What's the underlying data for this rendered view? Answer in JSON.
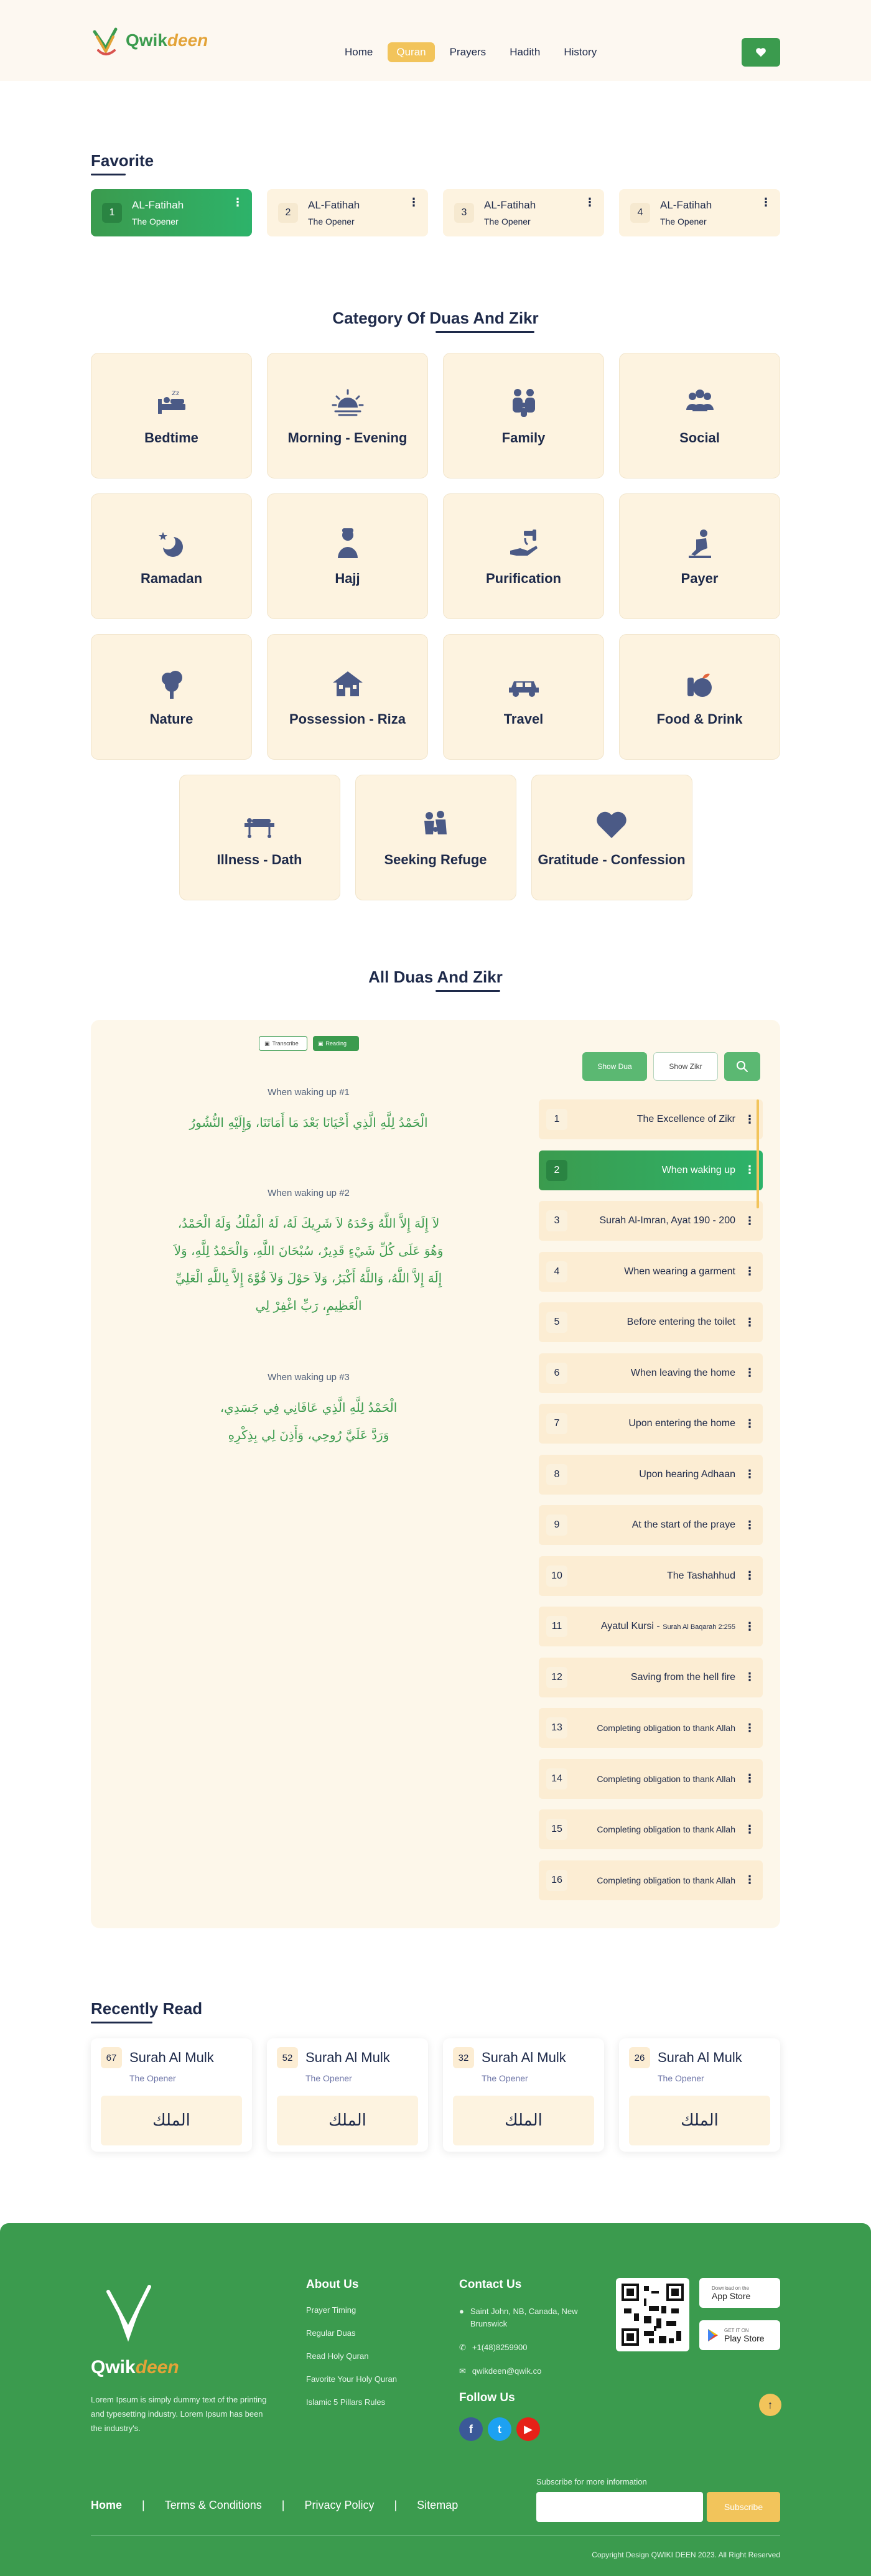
{
  "header": {
    "logo_prefix": "Qwik",
    "logo_suffix": "deen",
    "nav": [
      "Home",
      "Quran",
      "Prayers",
      "Hadith",
      "History"
    ],
    "active_nav": "Quran"
  },
  "favorite": {
    "title": "Favorite",
    "cards": [
      {
        "num": "1",
        "title": "AL-Fatihah",
        "sub": "The Opener"
      },
      {
        "num": "2",
        "title": "AL-Fatihah",
        "sub": "The Opener"
      },
      {
        "num": "3",
        "title": "AL-Fatihah",
        "sub": "The Opener"
      },
      {
        "num": "4",
        "title": "AL-Fatihah",
        "sub": "The Opener"
      }
    ]
  },
  "categories": {
    "title": "Category Of Duas And Zikr",
    "items": [
      {
        "label": "Bedtime",
        "icon": "bed-icon"
      },
      {
        "label": "Morning - Evening",
        "icon": "sunrise-icon"
      },
      {
        "label": "Family",
        "icon": "family-icon"
      },
      {
        "label": "Social",
        "icon": "people-icon"
      },
      {
        "label": "Ramadan",
        "icon": "crescent-icon"
      },
      {
        "label": "Hajj",
        "icon": "pilgrim-icon"
      },
      {
        "label": "Purification",
        "icon": "water-tap-icon"
      },
      {
        "label": "Payer",
        "icon": "prayer-icon"
      },
      {
        "label": "Nature",
        "icon": "tree-icon"
      },
      {
        "label": "Possession - Riza",
        "icon": "house-icon"
      },
      {
        "label": "Travel",
        "icon": "car-icon"
      },
      {
        "label": "Food & Drink",
        "icon": "food-icon"
      },
      {
        "label": "Illness - Dath",
        "icon": "stretcher-icon"
      },
      {
        "label": "Seeking Refuge",
        "icon": "refuge-icon"
      },
      {
        "label": "Gratitude - Confession",
        "icon": "heart-icon"
      }
    ]
  },
  "all_duas": {
    "title": "All Duas And Zikr",
    "toggle_left": "Transcribe",
    "toggle_right": "Reading",
    "show_dua": "Show Dua",
    "show_zikr": "Show Zikr",
    "duas": [
      {
        "head": "When waking up #1",
        "lines": [
          "الْحَمْدُ لِلَّهِ الَّذِي أَحْيَانَا بَعْدَ مَا أَمَاتَنَا، وَإِلَيْهِ النُّشُورُ"
        ]
      },
      {
        "head": "When waking up #2",
        "lines": [
          "لاَ إِلَهَ إِلاَّ اللَّهُ وَحْدَهُ لاَ شَرِيكَ لَهُ، لَهُ الْمُلْكُ وَلَهُ الْحَمْدُ،",
          "وَهُوَ عَلَى كُلِّ شَيْءٍ قَدِيرٌ، سُبْحَانَ اللَّهِ، وَالْحَمْدُ لِلَّهِ، وَلاَ",
          "إِلَهَ إِلاَّ اللَّهُ، وَاللَّهُ أَكْبَرُ، وَلاَ حَوْلَ وَلاَ قُوَّةَ إِلاَّ بِاللَّهِ الْعَلِيِّ",
          "الْعَظِيمِ، رَبِّ اغْفِرْ لِي"
        ]
      },
      {
        "head": "When waking up #3",
        "lines": [
          "الْحَمْدُ لِلَّهِ الَّذِي عَافَانِي فِي جَسَدِي،",
          "وَرَدَّ عَلَيَّ رُوحِي، وَأَذِنَ لِي بِذِكْرِهِ"
        ]
      }
    ],
    "list": [
      {
        "num": "1",
        "title": "The Excellence of Zikr"
      },
      {
        "num": "2",
        "title": "When waking up"
      },
      {
        "num": "3",
        "title": "Surah Al-Imran, Ayat 190 - 200"
      },
      {
        "num": "4",
        "title": "When wearing a garment"
      },
      {
        "num": "5",
        "title": "Before entering the toilet"
      },
      {
        "num": "6",
        "title": "When leaving the home"
      },
      {
        "num": "7",
        "title": "Upon entering the home"
      },
      {
        "num": "8",
        "title": "Upon hearing Adhaan"
      },
      {
        "num": "9",
        "title": "At the start of the praye"
      },
      {
        "num": "10",
        "title": "The Tashahhud"
      },
      {
        "num": "11",
        "title": "Ayatul Kursi - ",
        "note": "Surah Al Baqarah 2:255"
      },
      {
        "num": "12",
        "title": "Saving from the hell fire"
      },
      {
        "num": "13",
        "title": "Completing obligation to thank Allah"
      },
      {
        "num": "14",
        "title": "Completing obligation to thank Allah"
      },
      {
        "num": "15",
        "title": "Completing obligation to thank Allah"
      },
      {
        "num": "16",
        "title": "Completing obligation to thank Allah"
      }
    ],
    "active_index": 1
  },
  "recent": {
    "title": "Recently Read",
    "cards": [
      {
        "num": "67",
        "name": "Surah Al Mulk",
        "sub": "The Opener",
        "arabic": "الملك"
      },
      {
        "num": "52",
        "name": "Surah Al Mulk",
        "sub": "The Opener",
        "arabic": "الملك"
      },
      {
        "num": "32",
        "name": "Surah Al Mulk",
        "sub": "The Opener",
        "arabic": "الملك"
      },
      {
        "num": "26",
        "name": "Surah Al Mulk",
        "sub": "The Opener",
        "arabic": "الملك"
      }
    ]
  },
  "footer": {
    "logo_prefix": "Qwik",
    "logo_suffix": "deen",
    "description": "Lorem Ipsum is simply dummy text of the printing and typesetting industry. Lorem Ipsum has been the industry's.",
    "about_title": "About Us",
    "about_links": [
      "Prayer Timing",
      "Regular Duas",
      "Read Holy Quran",
      "Favorite Your Holy Quran",
      "Islamic 5 Pillars Rules"
    ],
    "contact_title": "Contact Us",
    "address": "Saint John, NB, Canada, New Brunswick",
    "phone": "+1(48)8259900",
    "email": "qwikdeen@qwik.co",
    "follow_title": "Follow Us",
    "app_store_small": "Download on the",
    "app_store": "App Store",
    "play_store_small": "GET IT ON",
    "play_store": "Play Store",
    "bottom_links": [
      "Home",
      "Terms & Conditions",
      "Privacy Policy",
      "Sitemap"
    ],
    "subscribe_label": "Subscribe for more information",
    "subscribe_btn": "Subscribe",
    "copyright": "Copyright Design QWIKI DEEN 2023. All Right Reserved"
  },
  "colors": {
    "green": "#3b9b4e",
    "yellow": "#f2c45b",
    "cream": "#fdf3e0",
    "navy": "#1e2a4a"
  }
}
